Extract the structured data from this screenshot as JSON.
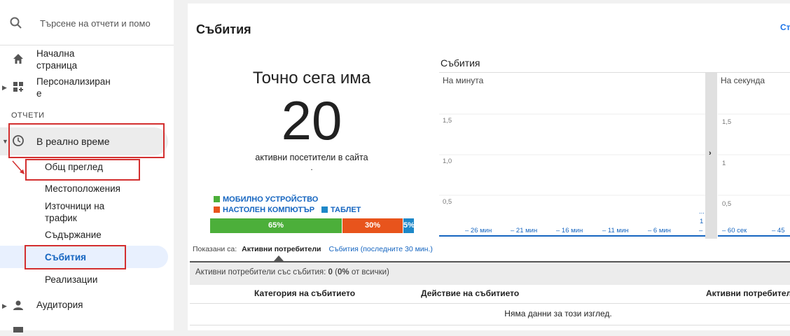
{
  "search": {
    "placeholder": "Търсене на отчети и помо"
  },
  "sidebar": {
    "home_label_1": "Начална",
    "home_label_2": "страница",
    "custom_label_1": "Персонализиран",
    "custom_label_2": "е",
    "section_reports": "ОТЧЕТИ",
    "realtime_label": "В реално време",
    "sub_items": [
      "Общ преглед",
      "Местоположения",
      "Източници на",
      "трафик",
      "Съдържание",
      "Събития",
      "Реализации"
    ],
    "audience_label": "Аудитория"
  },
  "page": {
    "title": "Събития",
    "top_right_link": "Ст"
  },
  "now": {
    "title": "Точно сега има",
    "count": "20",
    "subtitle": "активни посетители в сайта",
    "dot": "."
  },
  "devices": [
    {
      "name": "МОБИЛНО УСТРОЙСТВО",
      "percent_label": "65%",
      "share": 65,
      "color": "#4caf3a"
    },
    {
      "name": "НАСТОЛЕН КОМПЮТЪР",
      "percent_label": "30%",
      "share": 30,
      "color": "#e8541c"
    },
    {
      "name": "ТАБЛЕТ",
      "percent_label": "5%",
      "share": 5,
      "color": "#1e88c8"
    }
  ],
  "chart": {
    "title": "Събития",
    "panel_minute": "На минута",
    "panel_second": "На секунда",
    "y_ticks_minute": [
      "1,5",
      "1,0",
      "0,5"
    ],
    "y_ticks_second": [
      "1,5",
      "1",
      "0,5"
    ],
    "x_ticks_minute": [
      "– 26 мин",
      "– 21 мин",
      "– 16 мин",
      "– 11 мин",
      "– 6 мин"
    ],
    "x_ticks_second": [
      "– 60 сек",
      "– 45"
    ],
    "marker_1": "1",
    "marker_dash": "–",
    "marker_dots": "...",
    "colors": {
      "accent": "#1565c0"
    }
  },
  "shown": {
    "label": "Показани са:",
    "active": "Активни потребители",
    "events_link": "Събития (последните 30 мин.)"
  },
  "table": {
    "summary_label": "Активни потребители със събития:",
    "summary_value": "0",
    "summary_pct": "0%",
    "summary_rest": "от всички)",
    "columns": [
      "Категория на събитието",
      "Действие на събитието",
      "Активни потребител"
    ],
    "empty": "Няма данни за този изглед."
  }
}
